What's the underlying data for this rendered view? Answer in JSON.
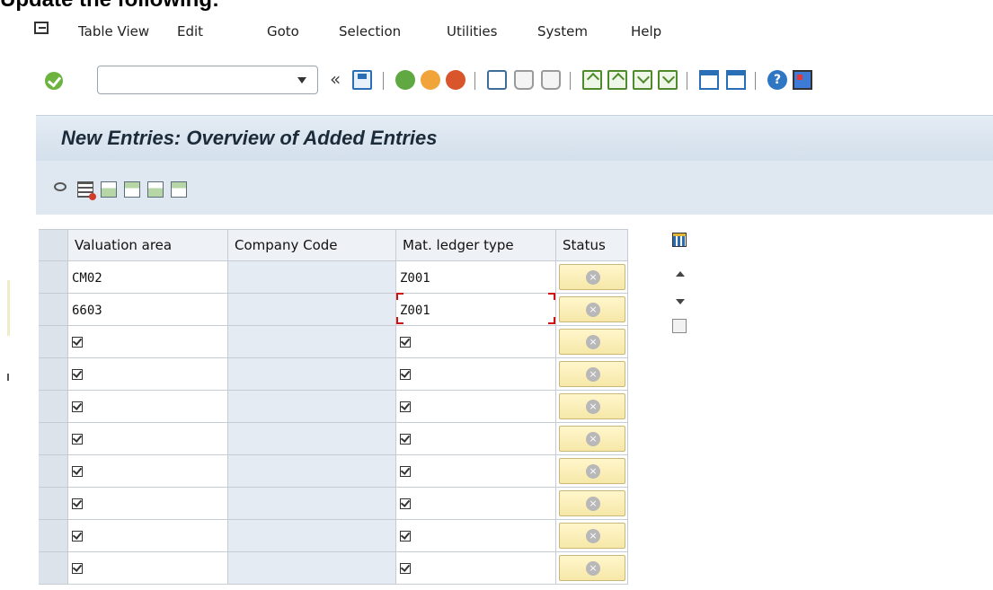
{
  "caption": "Update the following:",
  "menu": [
    "Table View",
    "Edit",
    "Goto",
    "Selection",
    "Utilities",
    "System",
    "Help"
  ],
  "toolbar": {
    "command_value": ""
  },
  "screen_title": "New Entries: Overview of Added Entries",
  "table": {
    "columns": [
      "Valuation area",
      "Company Code",
      "Mat. ledger type",
      "Status"
    ],
    "rows": [
      {
        "valuation_area": "CM02",
        "company_code": "",
        "mat_ledger_type": "Z001"
      },
      {
        "valuation_area": "6603",
        "company_code": "",
        "mat_ledger_type": "Z001"
      },
      {
        "valuation_area": "",
        "company_code": "",
        "mat_ledger_type": ""
      },
      {
        "valuation_area": "",
        "company_code": "",
        "mat_ledger_type": ""
      },
      {
        "valuation_area": "",
        "company_code": "",
        "mat_ledger_type": ""
      },
      {
        "valuation_area": "",
        "company_code": "",
        "mat_ledger_type": ""
      },
      {
        "valuation_area": "",
        "company_code": "",
        "mat_ledger_type": ""
      },
      {
        "valuation_area": "",
        "company_code": "",
        "mat_ledger_type": ""
      },
      {
        "valuation_area": "",
        "company_code": "",
        "mat_ledger_type": ""
      },
      {
        "valuation_area": "",
        "company_code": "",
        "mat_ledger_type": ""
      }
    ]
  },
  "icons": {
    "ok": "check-circle-icon",
    "save": "save-icon",
    "back": "back-icon",
    "exit": "exit-icon",
    "cancel": "cancel-icon",
    "print": "print-icon",
    "find": "find-icon",
    "find_next": "find-next-icon",
    "first_page": "first-page-icon",
    "prev_page": "previous-page-icon",
    "next_page": "next-page-icon",
    "last_page": "last-page-icon",
    "new_session": "new-session-icon",
    "shortcut": "shortcut-icon",
    "help": "help-icon",
    "layout": "customize-layout-icon",
    "status": "status-inactive-icon"
  },
  "colors": {
    "title_bg": "#dbe5ef",
    "status_btn": "#f6e8a8",
    "ok_green": "#6db33f"
  }
}
